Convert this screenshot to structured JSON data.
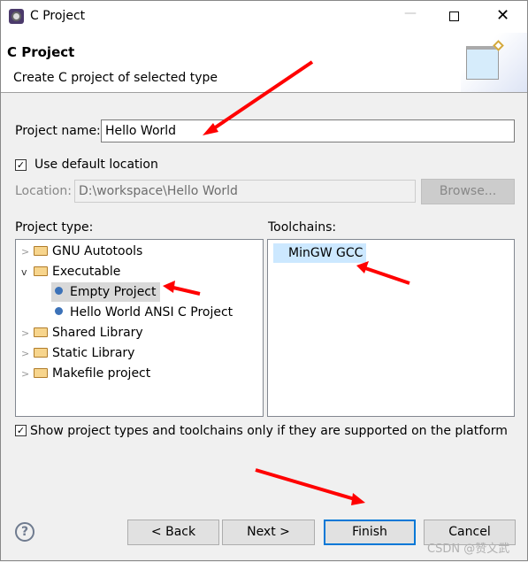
{
  "window": {
    "title": "C Project"
  },
  "header": {
    "title": "C Project",
    "subtitle": "Create C project of selected type"
  },
  "form": {
    "project_name_label": "Project name:",
    "project_name_value": "Hello World",
    "use_default_location_label": "Use default location",
    "use_default_location_checked": true,
    "location_label": "Location:",
    "location_value": "D:\\workspace\\Hello World",
    "browse_label": "Browse...",
    "project_type_label": "Project type:",
    "toolchains_label": "Toolchains:",
    "show_supported_label": "Show project types and toolchains only if they are supported on the platform",
    "show_supported_checked": true
  },
  "project_types": [
    {
      "label": "GNU Autotools",
      "kind": "folder",
      "expanded": false
    },
    {
      "label": "Executable",
      "kind": "folder",
      "expanded": true
    },
    {
      "label": "Empty Project",
      "kind": "item",
      "selected": true
    },
    {
      "label": "Hello World ANSI C Project",
      "kind": "item"
    },
    {
      "label": "Shared Library",
      "kind": "folder",
      "expanded": false
    },
    {
      "label": "Static Library",
      "kind": "folder",
      "expanded": false
    },
    {
      "label": "Makefile project",
      "kind": "folder",
      "expanded": false
    }
  ],
  "toolchains": [
    {
      "label": "MinGW GCC",
      "selected": true
    }
  ],
  "buttons": {
    "back": "< Back",
    "next": "Next >",
    "finish": "Finish",
    "cancel": "Cancel"
  },
  "watermark": "CSDN @赞文武",
  "colors": {
    "accent": "#0078d7",
    "selection": "#cce8ff",
    "annotation": "#ff0000"
  }
}
